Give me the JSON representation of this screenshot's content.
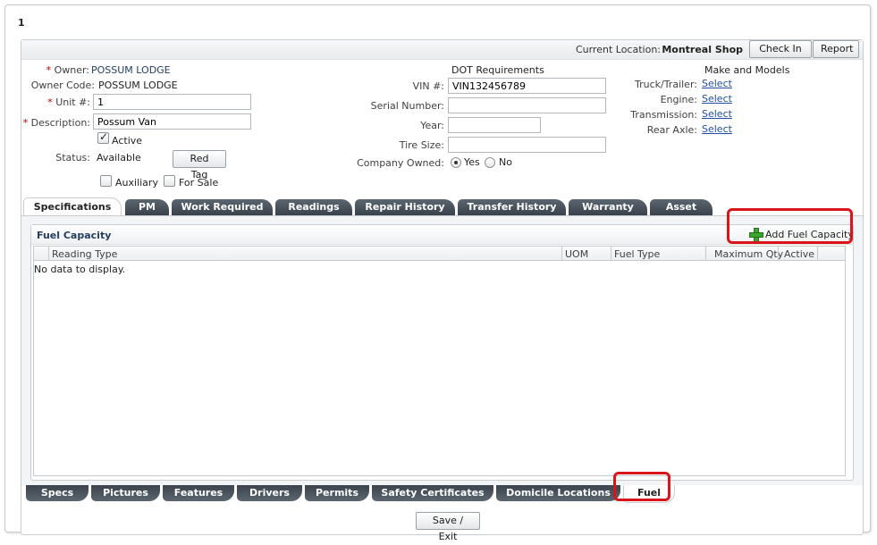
{
  "record": {
    "id": "1"
  },
  "header": {
    "location_label": "Current Location:",
    "location_value": "Montreal Shop",
    "check_in": "Check In",
    "report": "Report"
  },
  "form": {
    "owner_label": "Owner:",
    "owner_value": "POSSUM LODGE",
    "owner_code_label": "Owner Code:",
    "owner_code_value": "POSSUM LODGE",
    "unit_label": "Unit #:",
    "unit_value": "1",
    "description_label": "Description:",
    "description_value": "Possum Van",
    "active_label": "Active",
    "active_checked": true,
    "status_label": "Status:",
    "status_value": "Available",
    "red_tag": "Red Tag",
    "auxiliary_label": "Auxiliary",
    "auxiliary_checked": false,
    "for_sale_label": "For Sale",
    "for_sale_checked": false,
    "required_marker": "*"
  },
  "dot": {
    "heading": "DOT Requirements",
    "vin_label": "VIN #:",
    "vin_value": "VIN132456789",
    "serial_label": "Serial Number:",
    "serial_value": "",
    "year_label": "Year:",
    "year_value": "",
    "tire_label": "Tire Size:",
    "tire_value": "",
    "company_owned_label": "Company Owned:",
    "yes_label": "Yes",
    "no_label": "No",
    "company_owned": "Yes"
  },
  "make": {
    "heading": "Make and Models",
    "truck_label": "Truck/Trailer:",
    "engine_label": "Engine:",
    "transmission_label": "Transmission:",
    "rear_axle_label": "Rear Axle:",
    "select": "Select"
  },
  "top_tabs": [
    "Specifications",
    "PM",
    "Work Required",
    "Readings",
    "Repair History",
    "Transfer History",
    "Warranty",
    "Asset"
  ],
  "active_top_tab": "Specifications",
  "fuel": {
    "title": "Fuel Capacity",
    "add_button": "Add Fuel Capacity",
    "columns": [
      "Reading Type",
      "UOM",
      "Fuel Type",
      "Maximum Qty",
      "Active"
    ],
    "empty_text": "No data to display."
  },
  "bottom_tabs": [
    "Specs",
    "Pictures",
    "Features",
    "Drivers",
    "Permits",
    "Safety Certificates",
    "Domicile Locations",
    "Fuel"
  ],
  "active_bottom_tab": "Fuel",
  "footer": {
    "save_exit": "Save / Exit"
  },
  "colors": {
    "highlight": "#d9141b",
    "tab_dark": "#3b444c",
    "link": "#1f4f9e"
  }
}
